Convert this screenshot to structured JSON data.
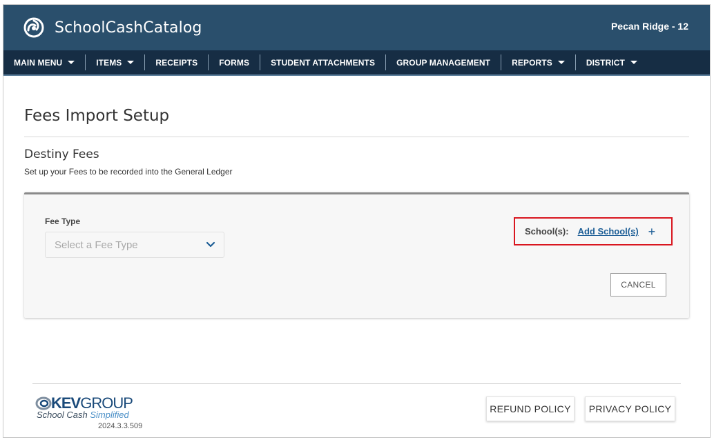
{
  "header": {
    "brand": "SchoolCashCatalog",
    "school": "Pecan Ridge - 12",
    "logo_icon": "swirl-logo-icon"
  },
  "nav": {
    "items": [
      {
        "label": "MAIN MENU",
        "dropdown": true
      },
      {
        "label": "ITEMS",
        "dropdown": true
      },
      {
        "label": "RECEIPTS",
        "dropdown": false
      },
      {
        "label": "FORMS",
        "dropdown": false
      },
      {
        "label": "STUDENT ATTACHMENTS",
        "dropdown": false
      },
      {
        "label": "GROUP MANAGEMENT",
        "dropdown": false
      },
      {
        "label": "REPORTS",
        "dropdown": true
      },
      {
        "label": "DISTRICT",
        "dropdown": true
      }
    ]
  },
  "main": {
    "page_title": "Fees Import Setup",
    "section_title": "Destiny Fees",
    "section_subtitle": "Set up your Fees to be recorded into the General Ledger",
    "form": {
      "fee_type_label": "Fee Type",
      "fee_type_placeholder": "Select a Fee Type",
      "schools_label": "School(s):",
      "add_school_link": "Add School(s)",
      "add_icon": "+",
      "cancel_label": "CANCEL"
    }
  },
  "footer": {
    "logo_kev": "KEV",
    "logo_group": "GROUP",
    "tagline_a": "School Cash",
    "tagline_b": "Simplified",
    "version": "2024.3.3.509",
    "refund_label": "REFUND POLICY",
    "privacy_label": "PRIVACY POLICY"
  },
  "colors": {
    "header_bg": "#2a4f6c",
    "nav_bg": "#162d44",
    "link": "#1d5e96",
    "highlight_box": "#d9161f"
  }
}
